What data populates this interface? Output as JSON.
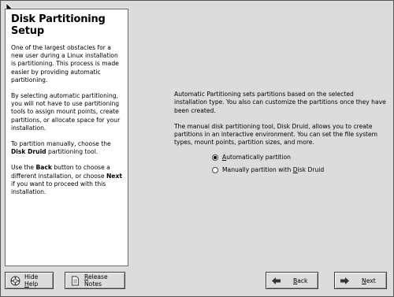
{
  "help": {
    "title": "Disk Partitioning Setup",
    "p1": "One of the largest obstacles for a new user during a Linux installation is partitioning. This process is made easier by providing automatic partitioning.",
    "p2": "By selecting automatic partitioning, you will not have to use partitioning tools to assign mount points, create partitions, or allocate space for your installation.",
    "p3_pre": "To partition manually, choose the ",
    "p3_bold": "Disk Druid",
    "p3_post": " partitioning tool.",
    "p4_a": "Use the ",
    "p4_b": "Back",
    "p4_c": " button to choose a different installation, or choose ",
    "p4_d": "Next",
    "p4_e": " if you want to proceed with this installation."
  },
  "main": {
    "p1": "Automatic Partitioning sets partitions based on the selected installation type. You also can customize the partitions once they have been created.",
    "p2": "The manual disk partitioning tool, Disk Druid, allows you to create partitions in an interactive environment. You can set the file system types, mount points, partition sizes, and more.",
    "options": [
      {
        "label_pre": "",
        "label_u": "A",
        "label_post": "utomatically partition",
        "selected": true
      },
      {
        "label_pre": "Manually partition with ",
        "label_u": "D",
        "label_post": "isk Druid",
        "selected": false
      }
    ]
  },
  "buttons": {
    "hide_help_pre": "Hide ",
    "hide_help_u": "H",
    "hide_help_post": "elp",
    "release_notes_pre": "",
    "release_notes_u": "R",
    "release_notes_post": "elease Notes",
    "back_pre": "",
    "back_u": "B",
    "back_post": "ack",
    "next_pre": "",
    "next_u": "N",
    "next_post": "ext"
  },
  "icons": {
    "help": "lifebuoy-icon",
    "notes": "document-icon",
    "back": "arrow-left-icon",
    "next": "arrow-right-icon",
    "cursor": "mouse-pointer-icon"
  }
}
